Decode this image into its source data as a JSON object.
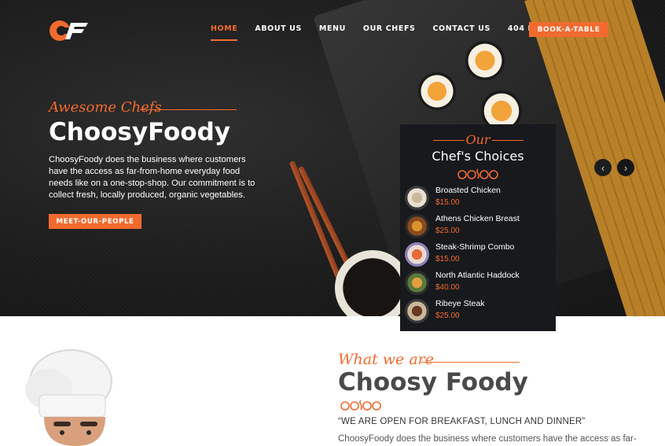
{
  "brand": {
    "accent": "#f26a2e",
    "dark": "#17191c",
    "logo_text": "CF"
  },
  "nav": {
    "items": [
      {
        "label": "HOME",
        "active": true
      },
      {
        "label": "ABOUT US"
      },
      {
        "label": "MENU"
      },
      {
        "label": "OUR CHEFS"
      },
      {
        "label": "CONTACT US"
      },
      {
        "label": "404 PAGE"
      }
    ],
    "book_label": "BOOK-A-TABLE"
  },
  "hero": {
    "script": "Awesome Chefs",
    "title": "ChoosyFoody",
    "description": "ChoosyFoody does the business where customers have the access as far-from-home everyday food needs like on a one-stop-shop. Our commitment is to collect fresh, locally produced, organic vegetables.",
    "button": "MEET-OUR-PEOPLE",
    "prev_icon": "chevron-left-icon",
    "next_icon": "chevron-right-icon"
  },
  "choices": {
    "script": "Our",
    "title": "Chef's Choices",
    "items": [
      {
        "name": "Broasted Chicken",
        "price": "$15.00"
      },
      {
        "name": "Athens Chicken Breast",
        "price": "$25.00"
      },
      {
        "name": "Steak-Shrimp Combo",
        "price": "$15.00"
      },
      {
        "name": "North Atlantic Haddock",
        "price": "$40.00"
      },
      {
        "name": "Ribeye Steak",
        "price": "$25.00"
      }
    ]
  },
  "about": {
    "script": "What we are",
    "title": "Choosy Foody",
    "tagline": "“WE ARE OPEN FOR BREAKFAST, LUNCH AND DINNER”",
    "description": "ChoosyFoody does the business where customers have the access as far-"
  }
}
